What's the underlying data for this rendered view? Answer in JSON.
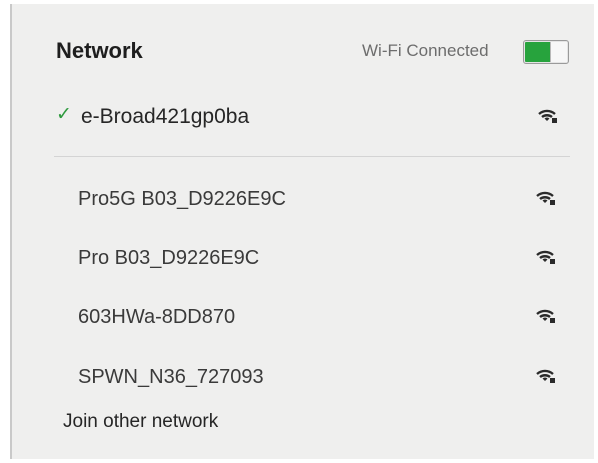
{
  "header": {
    "title": "Network",
    "wifi_status": "Wi-Fi Connected",
    "wifi_enabled": true
  },
  "connected": {
    "checkmark": "✓",
    "name": "e-Broad421gp0ba",
    "signal_icon": "wifi-lock-icon"
  },
  "networks": [
    {
      "name": "Pro5G B03_D9226E9C",
      "signal_icon": "wifi-lock-icon"
    },
    {
      "name": "Pro B03_D9226E9C",
      "signal_icon": "wifi-lock-icon"
    },
    {
      "name": "603HWa-8DD870",
      "signal_icon": "wifi-lock-icon"
    },
    {
      "name": "SPWN_N36_727093",
      "signal_icon": "wifi-lock-icon"
    }
  ],
  "footer": {
    "join_label": "Join other network"
  },
  "colors": {
    "toggle_on": "#27a33d",
    "checkmark": "#2e9a3e",
    "panel_bg": "#efefee"
  }
}
